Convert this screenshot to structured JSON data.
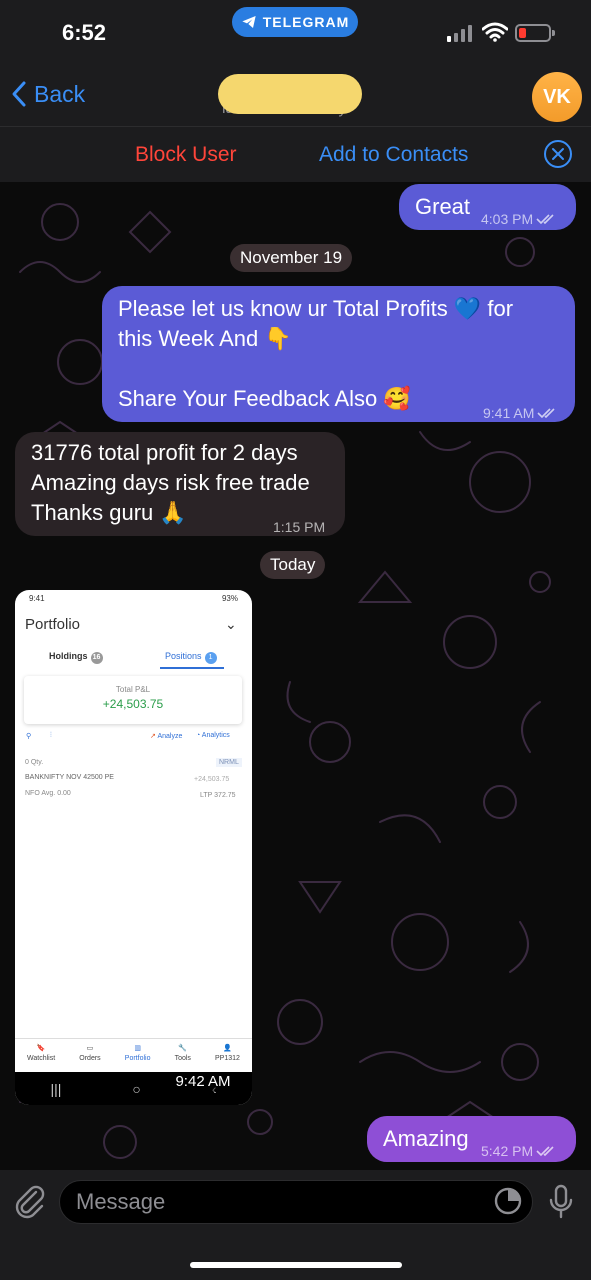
{
  "status_bar": {
    "time": "6:52",
    "pill": "TELEGRAM"
  },
  "nav": {
    "back_label": "Back",
    "subtitle": "last seen recently",
    "avatar_initials": "VK"
  },
  "actions": {
    "block": "Block User",
    "add": "Add to Contacts"
  },
  "messages": [
    {
      "id": "m1",
      "text": "Great",
      "time": "4:03 PM"
    },
    {
      "id": "date1",
      "text": "November 19"
    },
    {
      "id": "m2",
      "line1": "Please let us know ur Total Profits 💙 for",
      "line2": "this Week And 👇",
      "line3": "Share Your Feedback Also 🥰",
      "time": "9:41 AM"
    },
    {
      "id": "m3",
      "line1": "31776 total profit for 2 days",
      "line2": "Amazing days risk free trade",
      "line3": "Thanks guru 🙏",
      "time": "1:15 PM"
    },
    {
      "id": "date2",
      "text": "Today"
    },
    {
      "id": "m5",
      "text": "Amazing",
      "time": "5:42 PM"
    }
  ],
  "screenshot": {
    "status_time": "9:41",
    "status_battery": "93%",
    "title": "Portfolio",
    "tab_holdings": "Holdings",
    "tab_holdings_count": "16",
    "tab_positions": "Positions",
    "tab_positions_count": "1",
    "pnl_label": "Total P&L",
    "pnl_value": "+24,503.75",
    "analyze": "Analyze",
    "analytics": "Analytics",
    "qty": "0 Qty.",
    "product": "NRML",
    "instrument": "BANKNIFTY NOV 42500 PE",
    "row_pnl": "+24,503.75",
    "exchange": "NFO",
    "avg_label": "Avg.",
    "avg_value": "0.00",
    "ltp_label": "LTP",
    "ltp_value": "372.75",
    "nav": [
      "Watchlist",
      "Orders",
      "Portfolio",
      "Tools",
      "PP1312"
    ],
    "time": "9:42 AM"
  },
  "input": {
    "placeholder": "Message"
  },
  "colors": {
    "outgoing_bubble": "#5b5bd6",
    "outgoing_bubble_last": "#8e4fd6",
    "incoming_bubble": "#2a2326",
    "accent_blue": "#3a8ef6",
    "danger": "#ff453a"
  }
}
